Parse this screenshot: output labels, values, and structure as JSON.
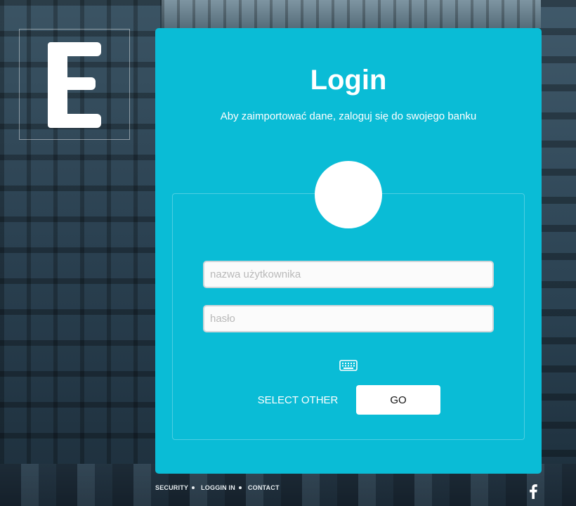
{
  "logo": {
    "letter": "E",
    "icon": "brand-logo-e"
  },
  "login": {
    "title": "Login",
    "subtitle": "Aby zaimportować dane, zaloguj się do swojego banku",
    "avatar_icon": "bank-avatar-placeholder",
    "username": {
      "value": "",
      "placeholder": "nazwa użytkownika"
    },
    "password": {
      "value": "",
      "placeholder": "hasło"
    },
    "keyboard_icon": "keyboard-icon",
    "select_other_label": "SELECT OTHER",
    "go_label": "GO"
  },
  "footer": {
    "links": [
      "SECURITY",
      "LOGGIN IN",
      "CONTACT"
    ],
    "social_icon": "facebook-icon"
  },
  "colors": {
    "card_background": "#0abcd6",
    "text_on_card": "#ffffff",
    "button_background": "#ffffff"
  }
}
